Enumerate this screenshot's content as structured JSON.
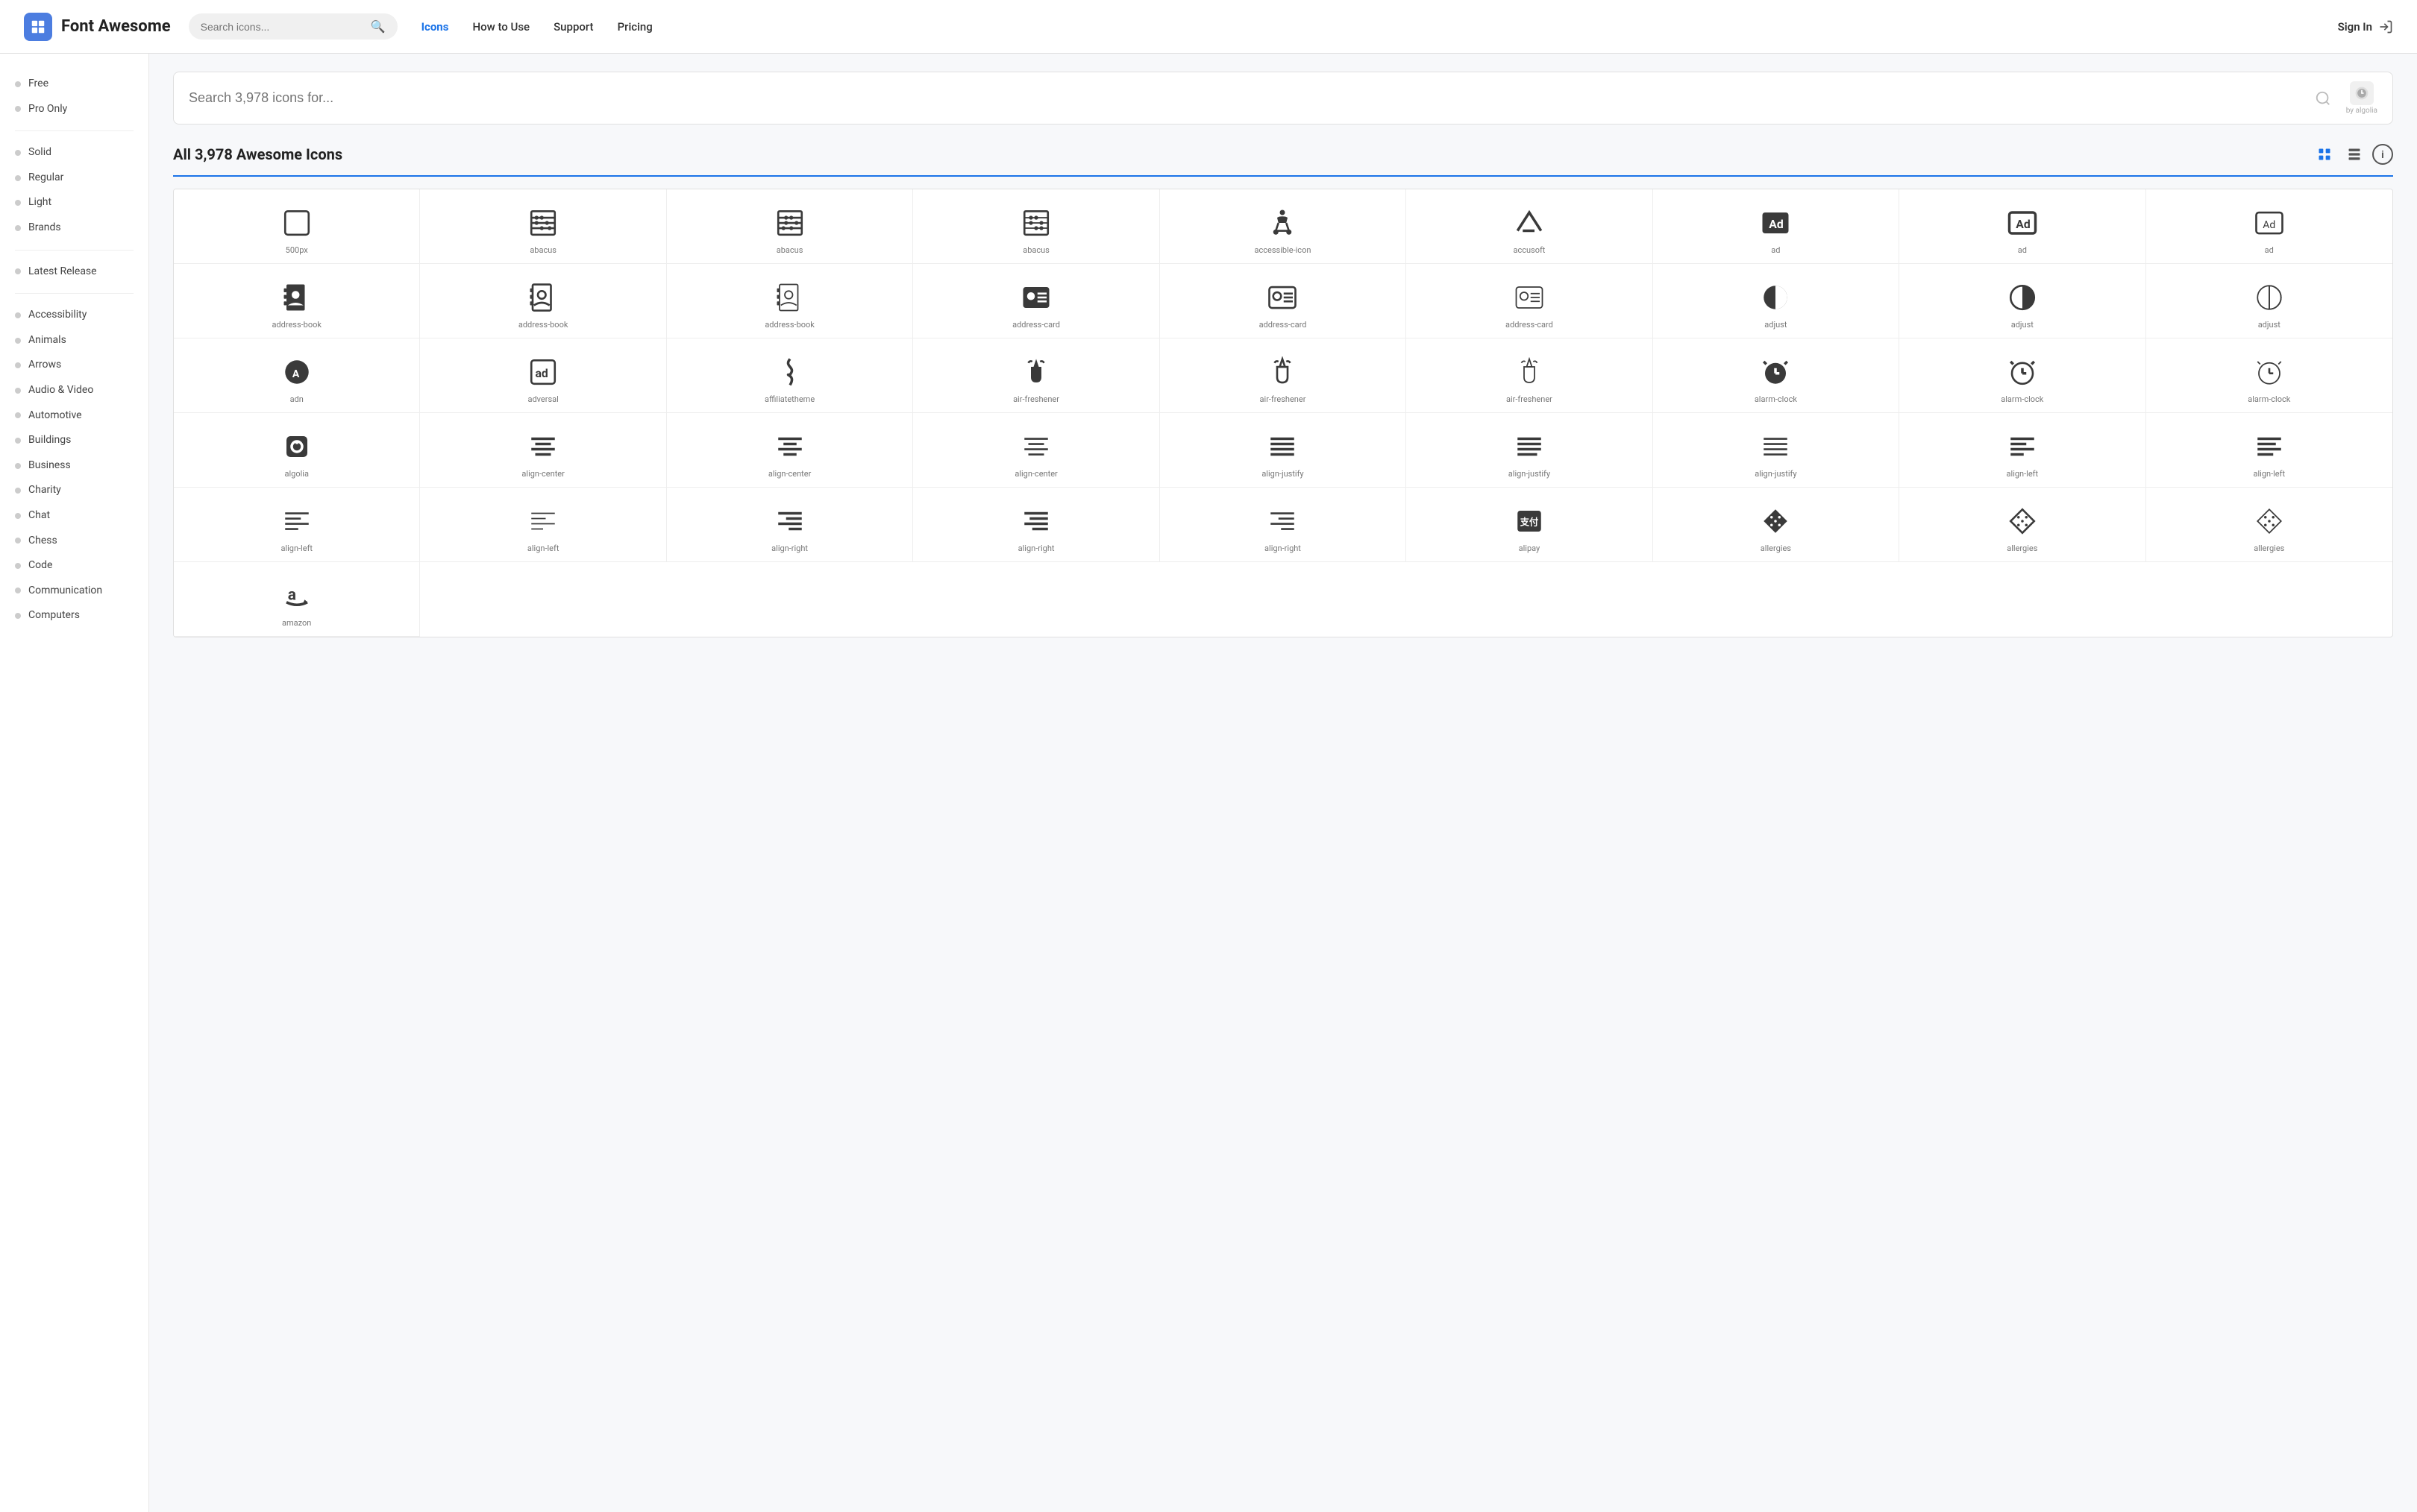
{
  "header": {
    "logo_text": "Font Awesome",
    "search_placeholder": "Search icons...",
    "nav": [
      {
        "label": "Icons",
        "active": true
      },
      {
        "label": "How to Use",
        "active": false
      },
      {
        "label": "Support",
        "active": false
      },
      {
        "label": "Pricing",
        "active": false
      }
    ],
    "signin_label": "Sign In"
  },
  "sidebar": {
    "filter_section": [
      {
        "label": "Free",
        "dot_color": "#555"
      },
      {
        "label": "Pro Only",
        "dot_color": "#555"
      }
    ],
    "style_section": [
      {
        "label": "Solid",
        "dot_color": "#555"
      },
      {
        "label": "Regular",
        "dot_color": "#555"
      },
      {
        "label": "Light",
        "dot_color": "#555"
      },
      {
        "label": "Brands",
        "dot_color": "#555"
      }
    ],
    "release_section": [
      {
        "label": "Latest Release",
        "dot_color": "#555"
      }
    ],
    "category_section": [
      {
        "label": "Accessibility"
      },
      {
        "label": "Animals"
      },
      {
        "label": "Arrows"
      },
      {
        "label": "Audio & Video"
      },
      {
        "label": "Automotive"
      },
      {
        "label": "Buildings"
      },
      {
        "label": "Business"
      },
      {
        "label": "Charity"
      },
      {
        "label": "Chat"
      },
      {
        "label": "Chess"
      },
      {
        "label": "Code"
      },
      {
        "label": "Communication"
      },
      {
        "label": "Computers"
      }
    ]
  },
  "main": {
    "search_placeholder": "Search 3,978 icons for...",
    "algolia_label": "by algolia",
    "section_title": "All 3,978 Awesome Icons",
    "icons": [
      {
        "name": "500px",
        "symbol": "5px"
      },
      {
        "name": "abacus",
        "symbol": "abacus1"
      },
      {
        "name": "abacus",
        "symbol": "abacus2"
      },
      {
        "name": "abacus",
        "symbol": "abacus3"
      },
      {
        "name": "accessible-icon",
        "symbol": "accessible"
      },
      {
        "name": "accusoft",
        "symbol": "accusoft"
      },
      {
        "name": "ad",
        "symbol": "ad1"
      },
      {
        "name": "ad",
        "symbol": "ad2"
      },
      {
        "name": "ad",
        "symbol": "ad3"
      },
      {
        "name": "address-book",
        "symbol": "addr-book1"
      },
      {
        "name": "address-book",
        "symbol": "addr-book2"
      },
      {
        "name": "address-book",
        "symbol": "addr-book3"
      },
      {
        "name": "address-card",
        "symbol": "addr-card1"
      },
      {
        "name": "address-card",
        "symbol": "addr-card2"
      },
      {
        "name": "address-card",
        "symbol": "addr-card3"
      },
      {
        "name": "adjust",
        "symbol": "adjust1"
      },
      {
        "name": "adjust",
        "symbol": "adjust2"
      },
      {
        "name": "adjust",
        "symbol": "adjust3"
      },
      {
        "name": "adn",
        "symbol": "adn"
      },
      {
        "name": "adversal",
        "symbol": "adversal"
      },
      {
        "name": "affiliatetheme",
        "symbol": "affiliate"
      },
      {
        "name": "air-freshener",
        "symbol": "airfresh1"
      },
      {
        "name": "air-freshener",
        "symbol": "airfresh2"
      },
      {
        "name": "air-freshener",
        "symbol": "airfresh3"
      },
      {
        "name": "alarm-clock",
        "symbol": "alarm1"
      },
      {
        "name": "alarm-clock",
        "symbol": "alarm2"
      },
      {
        "name": "alarm-clock",
        "symbol": "alarm3"
      },
      {
        "name": "algolia",
        "symbol": "algolia"
      },
      {
        "name": "align-center",
        "symbol": "align-c1"
      },
      {
        "name": "align-center",
        "symbol": "align-c2"
      },
      {
        "name": "align-center",
        "symbol": "align-c3"
      },
      {
        "name": "align-justify",
        "symbol": "align-j1"
      },
      {
        "name": "align-justify",
        "symbol": "align-j2"
      },
      {
        "name": "align-justify",
        "symbol": "align-j3"
      },
      {
        "name": "align-left",
        "symbol": "align-l1"
      },
      {
        "name": "align-left",
        "symbol": "align-l2"
      },
      {
        "name": "align-left",
        "symbol": "align-l3"
      },
      {
        "name": "align-left",
        "symbol": "align-l4"
      },
      {
        "name": "align-right",
        "symbol": "align-r1"
      },
      {
        "name": "align-right",
        "symbol": "align-r2"
      },
      {
        "name": "align-right",
        "symbol": "align-r3"
      },
      {
        "name": "alipay",
        "symbol": "alipay"
      },
      {
        "name": "allergies",
        "symbol": "allerg1"
      },
      {
        "name": "allergies",
        "symbol": "allerg2"
      },
      {
        "name": "allergies",
        "symbol": "allerg3"
      },
      {
        "name": "amazon",
        "symbol": "amazon"
      }
    ]
  }
}
